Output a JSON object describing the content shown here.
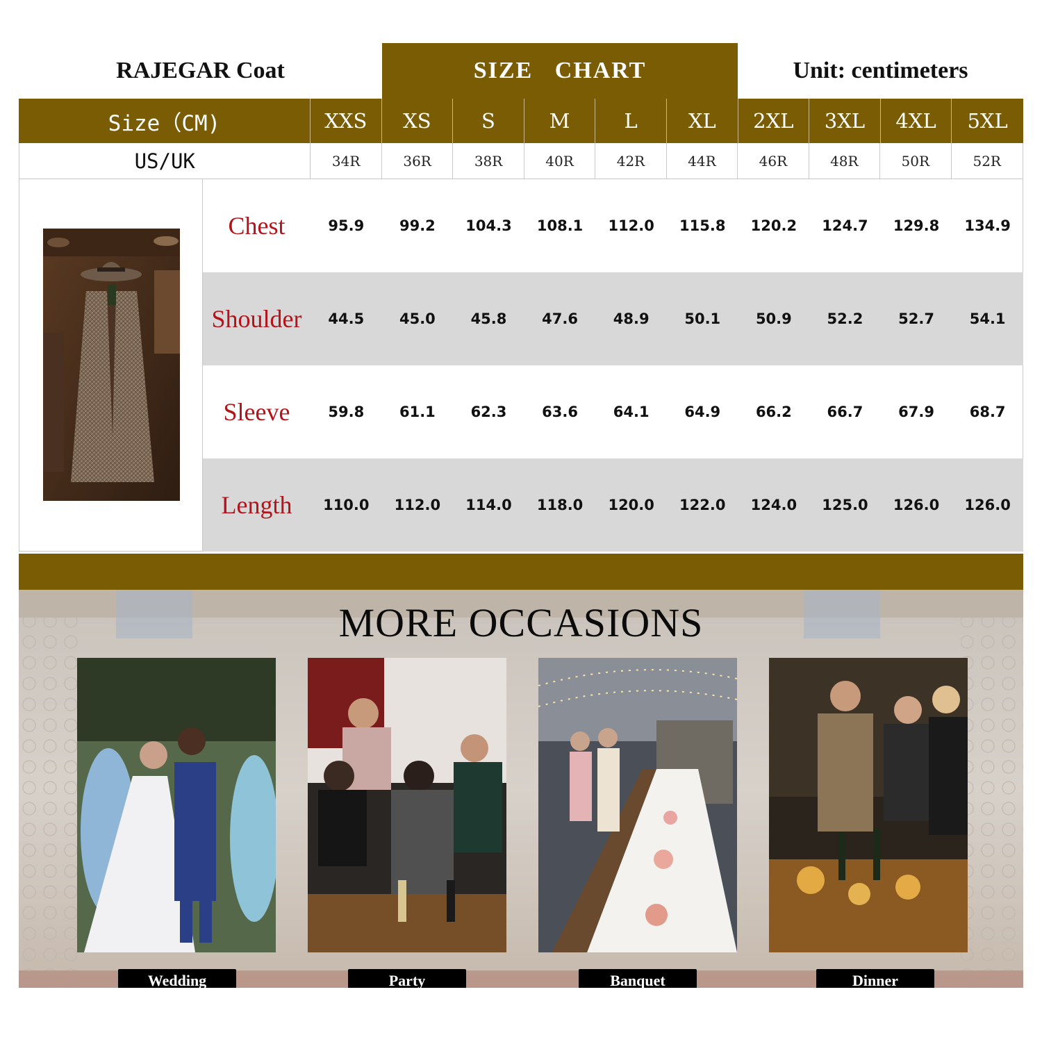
{
  "header": {
    "brand": "RAJEGAR Coat",
    "chart_title": "SIZE   CHART",
    "unit": "Unit: centimeters"
  },
  "table": {
    "size_header": "Size（CM)",
    "sizes": [
      "XXS",
      "XS",
      "S",
      "M",
      "L",
      "XL",
      "2XL",
      "3XL",
      "4XL",
      "5XL"
    ],
    "usuk_header": "US/UK",
    "usuk": [
      "34R",
      "36R",
      "38R",
      "40R",
      "42R",
      "44R",
      "46R",
      "48R",
      "50R",
      "52R"
    ],
    "rows": [
      {
        "label": "Chest",
        "values": [
          "95.9",
          "99.2",
          "104.3",
          "108.1",
          "112.0",
          "115.8",
          "120.2",
          "124.7",
          "129.8",
          "134.9"
        ]
      },
      {
        "label": "Shoulder",
        "values": [
          "44.5",
          "45.0",
          "45.8",
          "47.6",
          "48.9",
          "50.1",
          "50.9",
          "52.2",
          "52.7",
          "54.1"
        ]
      },
      {
        "label": "Sleeve",
        "values": [
          "59.8",
          "61.1",
          "62.3",
          "63.6",
          "64.1",
          "64.9",
          "66.2",
          "66.7",
          "67.9",
          "68.7"
        ]
      },
      {
        "label": "Length",
        "values": [
          "110.0",
          "112.0",
          "114.0",
          "118.0",
          "120.0",
          "122.0",
          "124.0",
          "125.0",
          "126.0",
          "126.0"
        ]
      }
    ]
  },
  "occasions": {
    "title": "MORE OCCASIONS",
    "items": [
      {
        "label": "Wedding"
      },
      {
        "label": "Party"
      },
      {
        "label": "Banquet"
      },
      {
        "label": "Dinner"
      }
    ]
  },
  "colors": {
    "brand_band": "#7a5c05",
    "label_red": "#b3141b",
    "row_shade": "#d9d8d8"
  }
}
